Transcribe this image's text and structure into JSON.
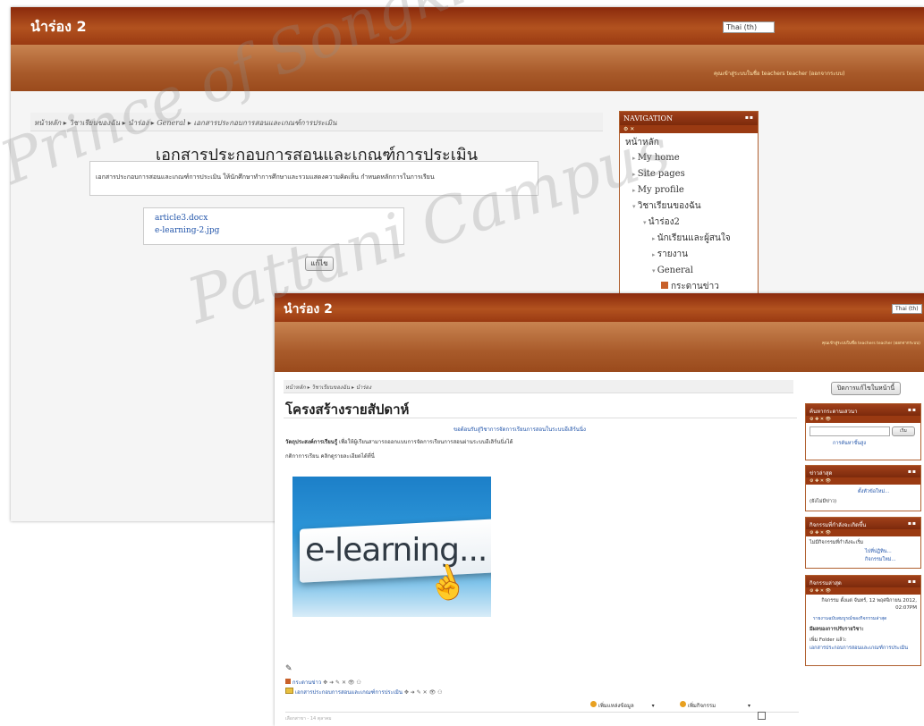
{
  "win1": {
    "site_title": "นำร่อง 2",
    "lang": "Thai (th)",
    "login": "คุณเข้าสู่ระบบในชื่อ teachers teacher (ออกจากระบบ)",
    "breadcrumb": "หน้าหลัก ▸ วิชาเรียนของฉัน ▸ นำร่อง ▸ General ▸ เอกสารประกอบการสอนและเกณฑ์การประเมิน",
    "page_title": "เอกสารประกอบการสอนและเกณฑ์การประเมิน",
    "description": "เอกสารประกอบการสอนและเกณฑ์การประเมิน ให้นักศึกษาทำการศึกษาและรวมแสดงความคิดเห็น กำหนดหลักการในการเรียน",
    "files": [
      "article3.docx",
      "e-learning-2.jpg"
    ],
    "edit_button": "แก้ไข",
    "nav": {
      "title": "NAVIGATION",
      "items": [
        "หน้าหลัก",
        "My home",
        "Site pages",
        "My profile",
        "วิชาเรียนของฉัน",
        "นำร่อง2",
        "นักเรียนและผู้สนใจ",
        "รายงาน",
        "General",
        "กระดานข่าว"
      ]
    }
  },
  "win2": {
    "site_title": "นำร่อง 2",
    "lang": "Thai (th)",
    "login": "คุณเข้าสู่ระบบในชื่อ teachers teacher (ออกจากระบบ)",
    "breadcrumb": "หน้าหลัก ▸ วิชาเรียนของฉัน ▸ นำร่อง",
    "edit_page_button": "ปิดการแก้ไขในหน้านี้",
    "page_title": "โครงสร้างรายสัปดาห์",
    "welcome": "ขอต้อนรับสู่วิชาการจัดการเรียนการสอนในระบบอีเลิร์นนิ่ง",
    "objective_label": "วัตถุประสงค์การเรียนรู้",
    "objective_text": "เพื่อให้ผู้เรียนสามารถออกแบบการจัดการเรียนการสอนผ่านระบบอีเลิร์นนิ่งได้",
    "rules": "กติกาการเรียน คลิกดูรายละเอียดได้ที่นี่",
    "image_text": "e-learning...",
    "activity1": "กระดานข่าว",
    "activity2": "เอกสารประกอบการสอนและเกณฑ์การประเมิน",
    "add_resource": "เพิ่มแหล่งข้อมูล",
    "add_activity": "เพิ่มกิจกรรม",
    "footer": "เลือกสาขา - 14 ตุลาคม",
    "blocks": {
      "search": {
        "title": "ค้นหากระดานเสวนา",
        "go": "เริ่ม",
        "advanced": "การค้นหาขั้นสูง"
      },
      "news": {
        "title": "ข่าวล่าสุด",
        "add": "ตั้งหัวข้อใหม่...",
        "none": "(ยังไม่มีข่าว)"
      },
      "upcoming": {
        "title": "กิจกรรมที่กำลังจะเกิดขึ้น",
        "none": "ไม่มีกิจกรรมที่กำลังจะเริ่ม",
        "calendar": "ไปที่ปฏิทิน...",
        "new_event": "กิจกรรมใหม่..."
      },
      "recent": {
        "title": "กิจกรรมล่าสุด",
        "since": "กิจกรรม ตั้งแต่ จันทร์, 12 พฤศจิกายน 2012, 02:07PM",
        "full_report": "รายงานฉบับสมบูรณ์ของกิจกรรมล่าสุด",
        "changes": "มีผลของการปรับรายวิชา:",
        "added": "เพิ่ม Folder แล้ว:",
        "added_item": "เอกสารประกอบการสอนและเกณฑ์การประเมิน"
      }
    }
  },
  "watermark": [
    "Prince of Songkla University",
    "Pattani Campus"
  ],
  "colors": {
    "header_dark": "#8b2a0c",
    "header_light": "#c88350",
    "link": "#2255aa",
    "block_head": "#a0401a"
  }
}
